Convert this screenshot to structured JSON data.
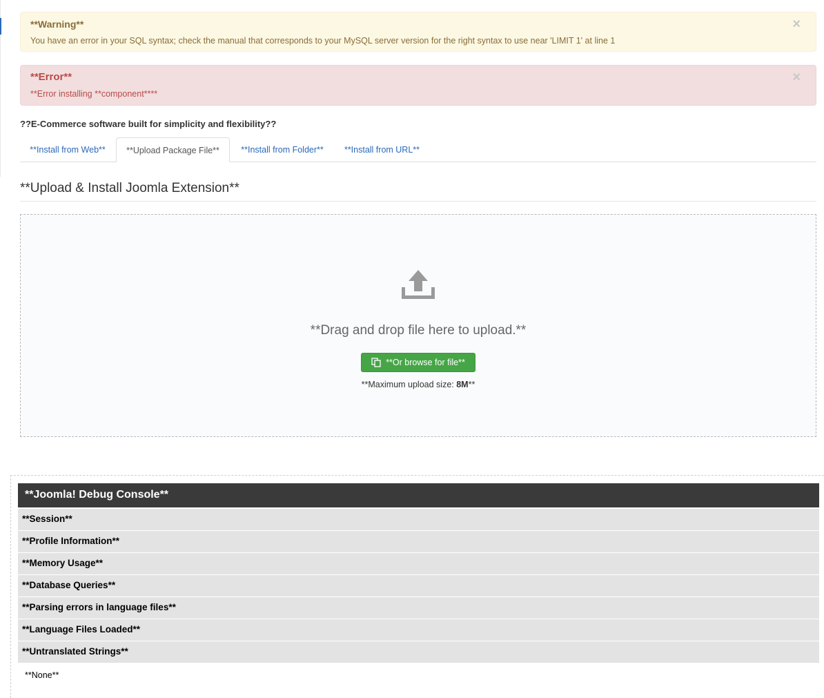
{
  "alerts": {
    "warning": {
      "heading": "**Warning**",
      "message": "You have an error in your SQL syntax; check the manual that corresponds to your MySQL server version for the right syntax to use near 'LIMIT 1' at line 1",
      "close": "×"
    },
    "error": {
      "heading": "**Error**",
      "message": "**Error installing **component****",
      "close": "×"
    }
  },
  "tagline": "??E-Commerce software built for simplicity and flexibility??",
  "tabs": [
    {
      "label": "**Install from Web**"
    },
    {
      "label": "**Upload Package File**",
      "active": true
    },
    {
      "label": "**Install from Folder**"
    },
    {
      "label": "**Install from URL**"
    }
  ],
  "upload": {
    "title": "**Upload & Install Joomla Extension**",
    "drag_text": "**Drag and drop file here to upload.**",
    "browse_label": "**Or browse for file**",
    "max_size_prefix": "**Maximum upload size: ",
    "max_size_value": "8M",
    "max_size_suffix": "**",
    "icon": "upload-icon",
    "button_icon": "copy-icon"
  },
  "debug": {
    "header": "**Joomla! Debug Console**",
    "rows": [
      "**Session**",
      "**Profile Information**",
      "**Memory Usage**",
      "**Database Queries**",
      "**Parsing errors in language files**",
      "**Language Files Loaded**",
      "**Untranslated Strings**"
    ],
    "none": "**None**"
  },
  "colors": {
    "link": "#2a69b8",
    "success": "#46a546",
    "warning_bg": "#fcf8e3",
    "error_bg": "#f2dede",
    "debug_header_bg": "#3a3a3a"
  }
}
